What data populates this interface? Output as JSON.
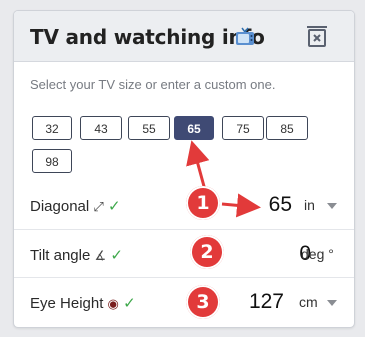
{
  "header": {
    "title": "TV and watching info",
    "tv_icon": "tv-icon",
    "trash_icon": "trash-icon"
  },
  "hint": "Select your TV size or enter a custom one.",
  "sizes": [
    "32",
    "43",
    "55",
    "65",
    "75",
    "85",
    "98"
  ],
  "selected_size": "65",
  "rows": [
    {
      "label": "Diagonal",
      "symbol": "⤢",
      "check": "✓",
      "value": "65",
      "unit": "in",
      "badge": "1"
    },
    {
      "label": "Tilt angle",
      "symbol": "∡",
      "check": "✓",
      "value": "0",
      "unit": "deg °",
      "badge": "2"
    },
    {
      "label": "Eye Height",
      "symbol": "◉",
      "check": "✓",
      "value": "127",
      "unit": "cm",
      "badge": "3"
    }
  ],
  "colors": {
    "accent": "#3f4a74",
    "badge": "#e23a3a",
    "check": "#3ea84b"
  }
}
